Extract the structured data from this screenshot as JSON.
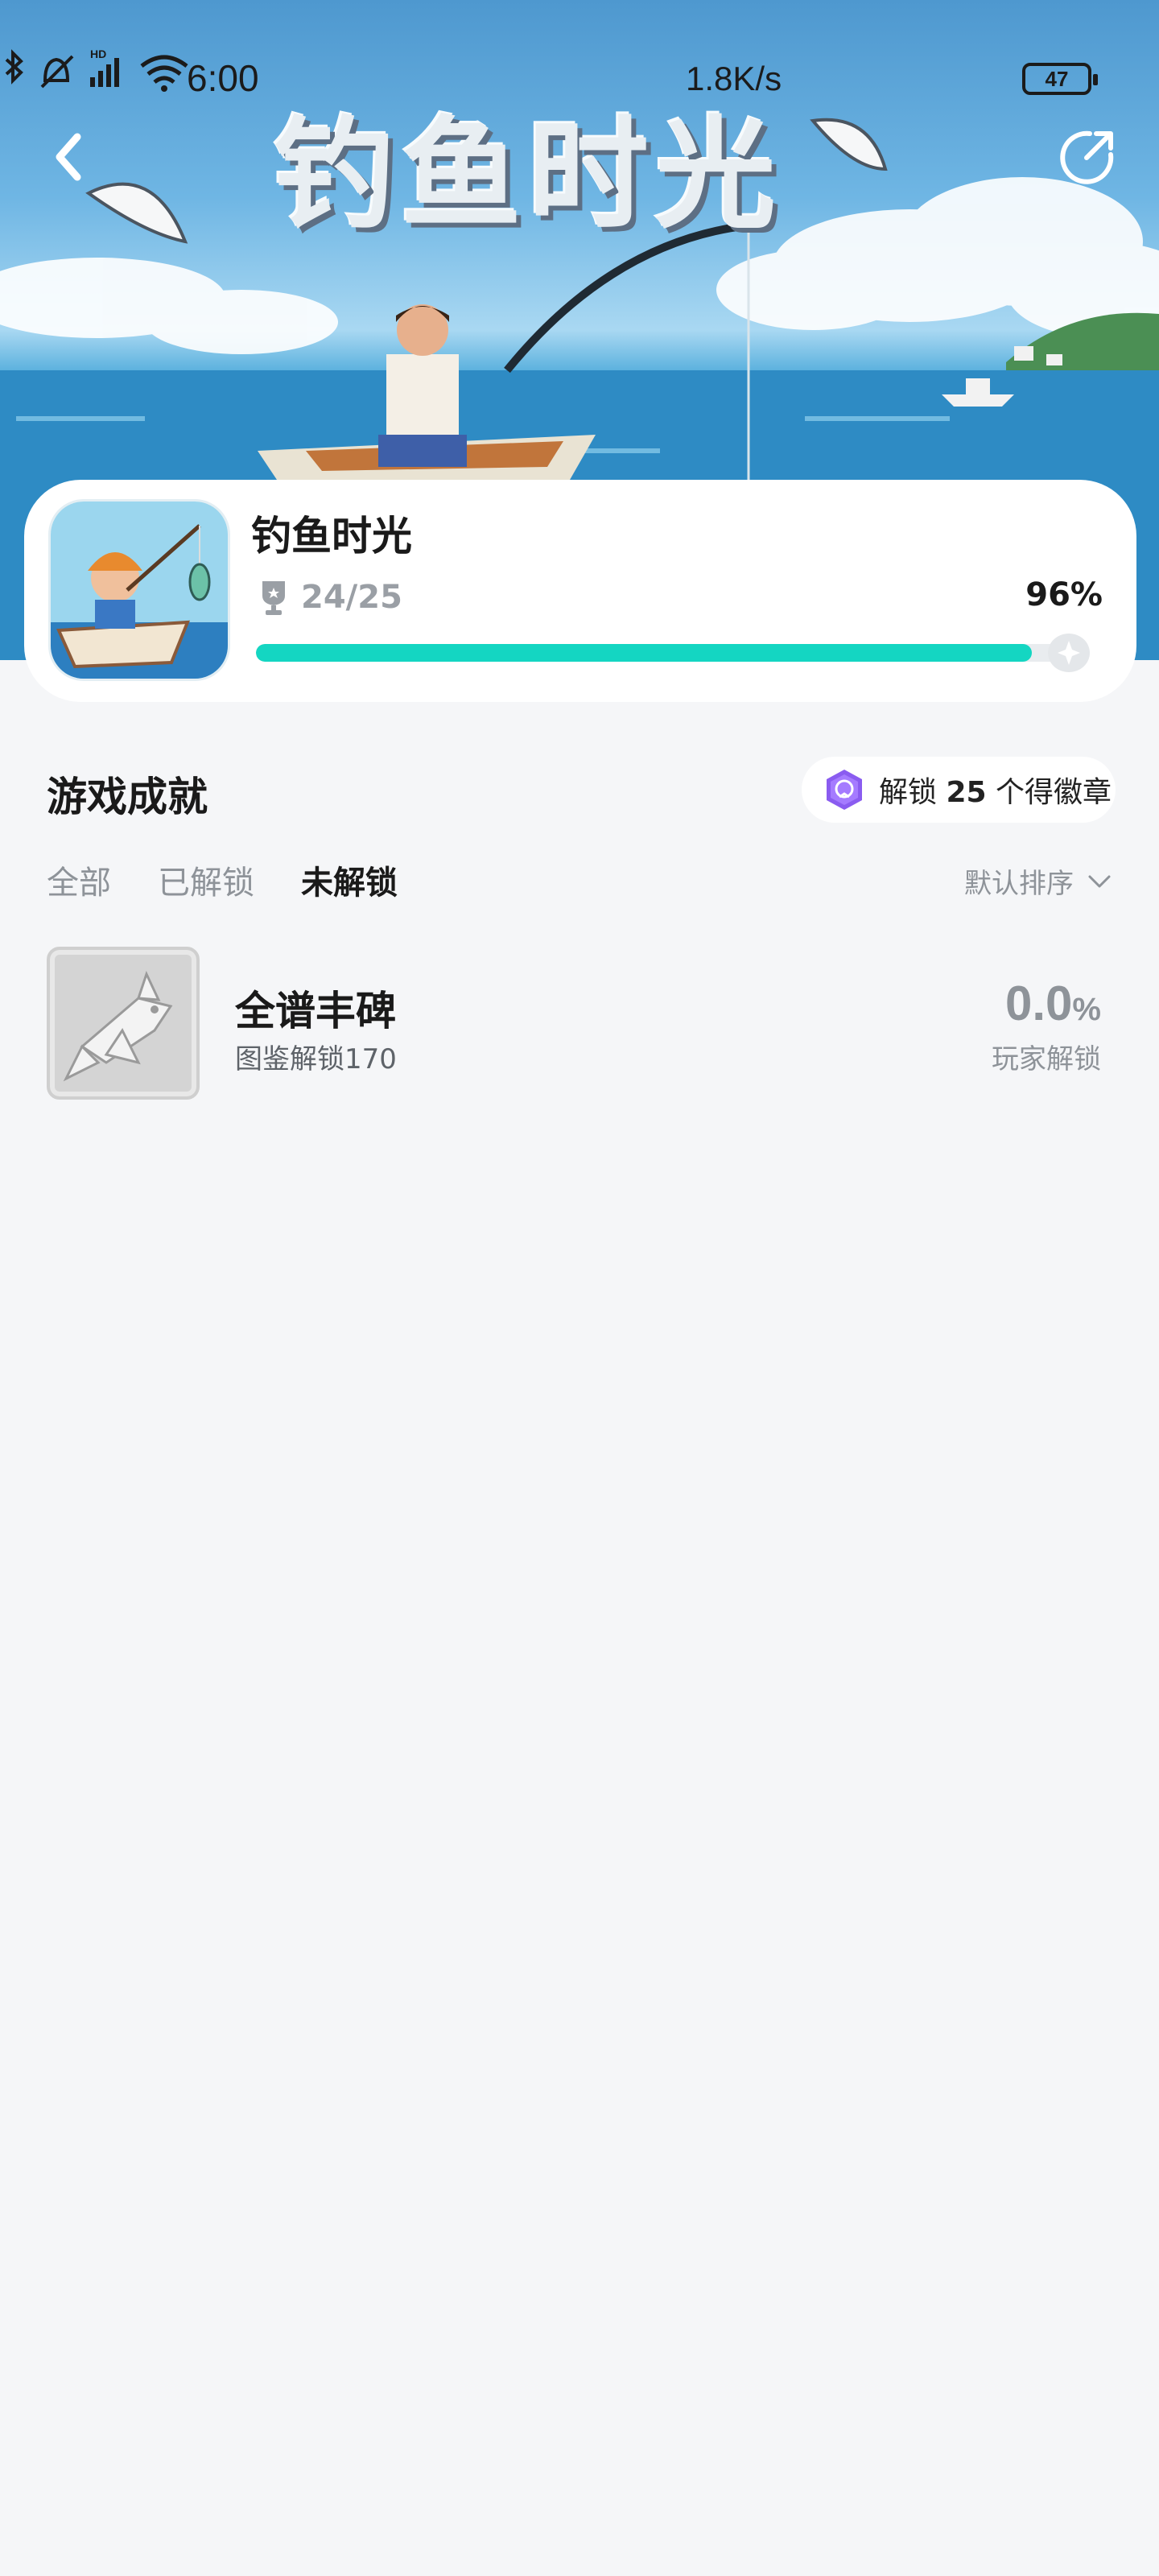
{
  "status_bar": {
    "time": "6:00",
    "network_speed": "1.8K/s",
    "battery": "47"
  },
  "banner": {
    "title": "钓鱼时光"
  },
  "game": {
    "name": "钓鱼时光",
    "trophies": "24/25",
    "percent_label": "96%",
    "progress": 0.96,
    "accent_color": "#14d6c2"
  },
  "section": {
    "title": "游戏成就",
    "badge_prefix": "解锁",
    "badge_count": "25",
    "badge_suffix": "个得徽章"
  },
  "tabs": [
    {
      "label": "全部",
      "active": false
    },
    {
      "label": "已解锁",
      "active": false
    },
    {
      "label": "未解锁",
      "active": true
    }
  ],
  "sort": {
    "label": "默认排序"
  },
  "achievements": [
    {
      "title": "全谱丰碑",
      "description": "图鉴解锁170",
      "rate_value": "0.0",
      "rate_unit": "%",
      "rate_label": "玩家解锁"
    }
  ]
}
